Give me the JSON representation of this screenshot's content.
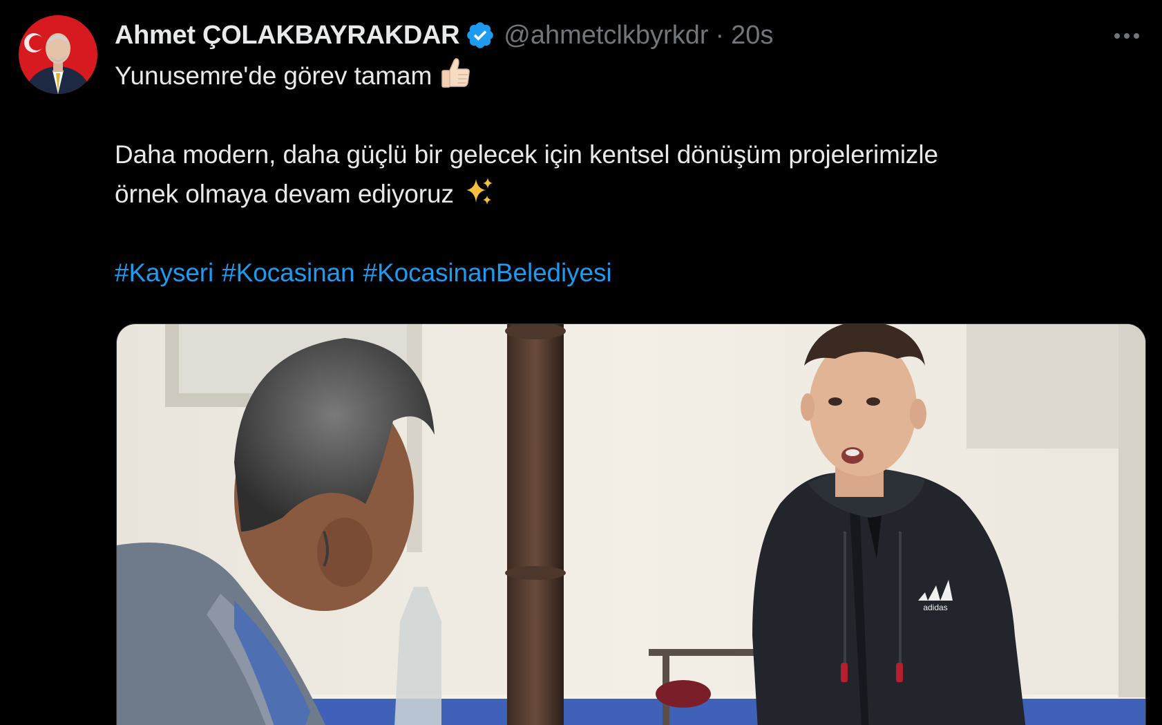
{
  "tweet": {
    "author": {
      "display_name": "Ahmet ÇOLAKBAYRAKDAR",
      "handle": "@ahmetclkbyrkdr",
      "verified": true
    },
    "separator": "·",
    "timestamp": "20s",
    "text_lines": [
      "Yunusemre'de görev tamam",
      "Daha modern, daha güçlü bir gelecek için kentsel dönüşüm projelerimizle",
      "örnek olmaya devam ediyoruz"
    ],
    "hashtags": [
      "#Kayseri",
      "#Kocasinan",
      "#KocasinanBelediyesi"
    ],
    "media": {
      "logo_text": "adidas"
    }
  },
  "colors": {
    "background": "#000000",
    "text": "#e7e9ea",
    "secondary": "#71767b",
    "link": "#1d9bf0",
    "verified": "#1d9bf0"
  },
  "icons": {
    "more": "more-horizontal-icon",
    "verified": "verified-badge-icon",
    "thumbs_up": "thumbs-up-emoji",
    "sparkles": "sparkles-emoji"
  }
}
